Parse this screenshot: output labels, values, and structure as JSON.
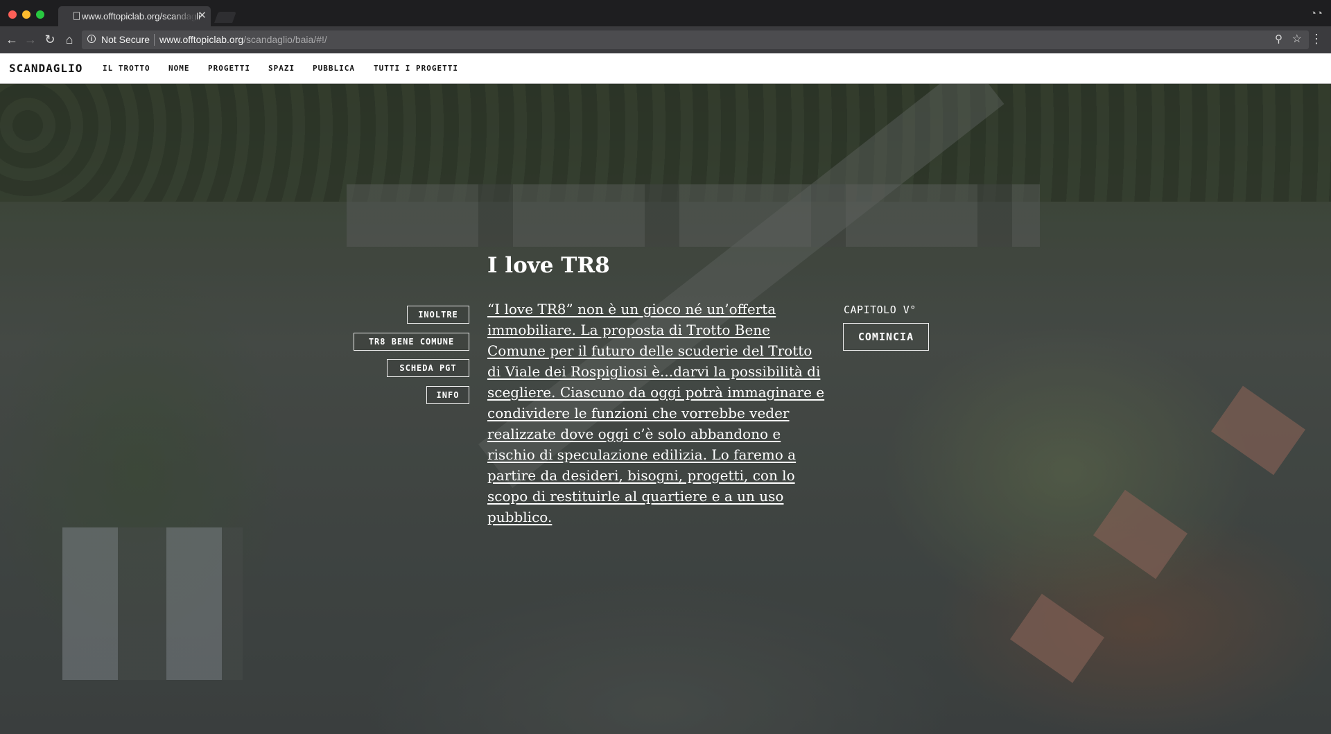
{
  "browser": {
    "tab_title": "www.offtopiclab.org/scandaglio",
    "security_label": "Not Secure",
    "url_host": "www.offtopiclab.org",
    "url_path": "/scandaglio/baia/#!/",
    "icons": {
      "back": "back-arrow-icon",
      "forward": "forward-arrow-icon",
      "reload": "reload-icon",
      "home": "home-icon",
      "info": "info-icon",
      "zoom": "zoom-icon",
      "bookmark": "star-icon",
      "menu": "kebab-menu-icon",
      "incognito": "incognito-icon",
      "close_tab": "close-icon",
      "page": "page-icon"
    }
  },
  "site": {
    "brand": "SCANDAGLIO",
    "nav": [
      "IL TROTTO",
      "NOME",
      "PROGETTI",
      "SPAZI",
      "PUBBLICA",
      "TUTTI I PROGETTI"
    ]
  },
  "hero": {
    "title": "I love TR8",
    "side_buttons": [
      "INOLTRE",
      "TR8 BENE COMUNE",
      "SCHEDA PGT",
      "INFO"
    ],
    "text": "“I love TR8” non è un gioco né un’offerta immobiliare. La proposta di Trotto Bene Comune per il futuro delle scuderie del Trotto di Viale dei Rospigliosi è...darvi la possibilità di scegliere. Ciascuno da oggi potrà immaginare e condividere le funzioni che vorrebbe veder realizzate dove oggi c’è solo abbandono e rischio di speculazione edilizia. Lo faremo a partire da desideri, bisogni, progetti, con lo scopo di restituirle al quartiere e a un uso pubblico.",
    "chapter_label": "CAPITOLO V°",
    "start_button": "COMINCIA"
  },
  "colors": {
    "chrome_dark": "#1e1e20",
    "chrome_toolbar": "#3b3b3e",
    "nav_bg": "#ffffff",
    "hero_text": "#ffffff"
  }
}
